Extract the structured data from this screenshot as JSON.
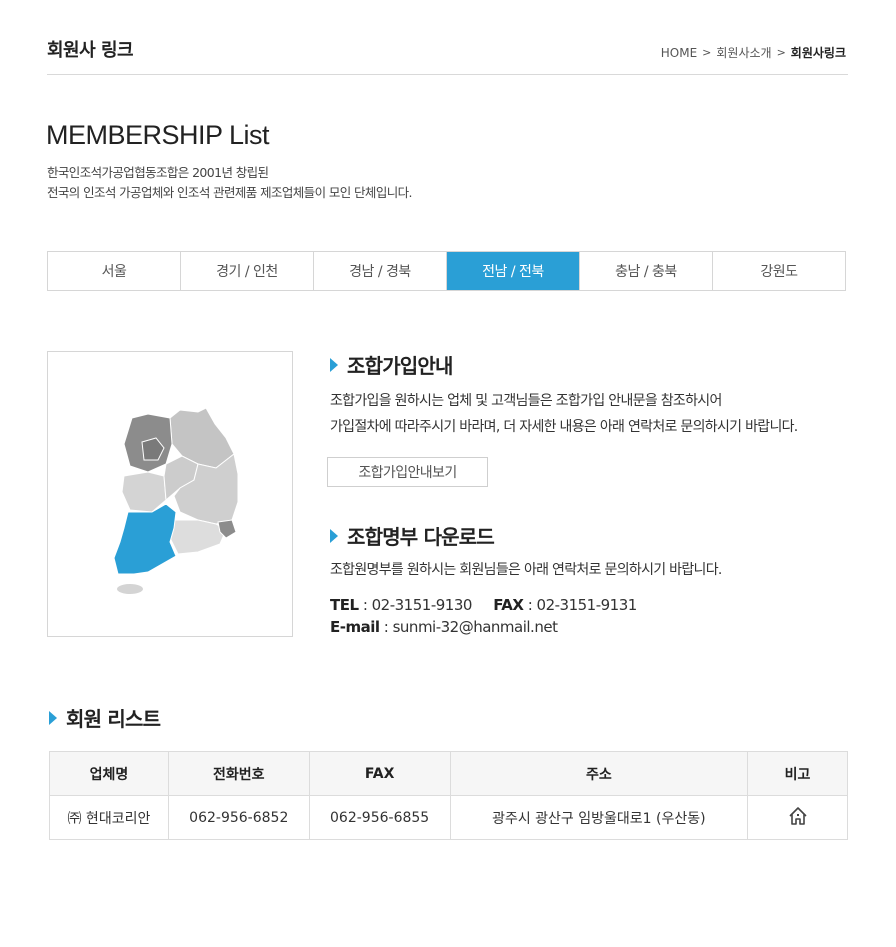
{
  "header": {
    "title": "회원사 링크",
    "breadcrumb": [
      "HOME",
      "회원사소개",
      "회원사링크"
    ]
  },
  "intro": {
    "title": "MEMBERSHIP List",
    "desc_line1": "한국인조석가공업협동조합은 2001년 창립된",
    "desc_line2": "전국의 인조석 가공업체와 인조석 관련제품 제조업체들이 모인 단체입니다."
  },
  "tabs": [
    {
      "label": "서울",
      "active": false
    },
    {
      "label": "경기 / 인천",
      "active": false
    },
    {
      "label": "경남 / 경북",
      "active": false
    },
    {
      "label": "전남 / 전북",
      "active": true
    },
    {
      "label": "충남 / 충북",
      "active": false
    },
    {
      "label": "강원도",
      "active": false
    }
  ],
  "map": {
    "highlight_color": "#2a9fd6",
    "base_color": "#d4d4d4",
    "dark_color": "#8c8c8c",
    "highlighted_region": "전남 / 전북"
  },
  "join": {
    "title": "조합가입안내",
    "line1": "조합가입을 원하시는 업체 및 고객님들은 조합가입 안내문을 참조하시어",
    "line2": "가입절차에 따라주시기 바라며, 더 자세한 내용은 아래 연락처로 문의하시기 바랍니다.",
    "button_label": "조합가입안내보기"
  },
  "roster": {
    "title": "조합명부 다운로드",
    "line1": "조합원명부를 원하시는 회원님들은 아래 연락처로 문의하시기 바랍니다.",
    "tel_label": "TEL",
    "tel": "02-3151-9130",
    "fax_label": "FAX",
    "fax": "02-3151-9131",
    "email_label": "E-mail",
    "email": "sunmi-32@hanmail.net"
  },
  "members": {
    "title": "회원 리스트",
    "columns": [
      "업체명",
      "전화번호",
      "FAX",
      "주소",
      "비고"
    ],
    "rows": [
      {
        "name": "㈜ 현대코리안",
        "phone": "062-956-6852",
        "fax": "062-956-6855",
        "address": "광주시 광산구 임방울대로1 (우산동)",
        "note_icon": "home-icon"
      }
    ]
  },
  "colors": {
    "accent": "#2a9fd6",
    "border": "#d6d6d6"
  }
}
